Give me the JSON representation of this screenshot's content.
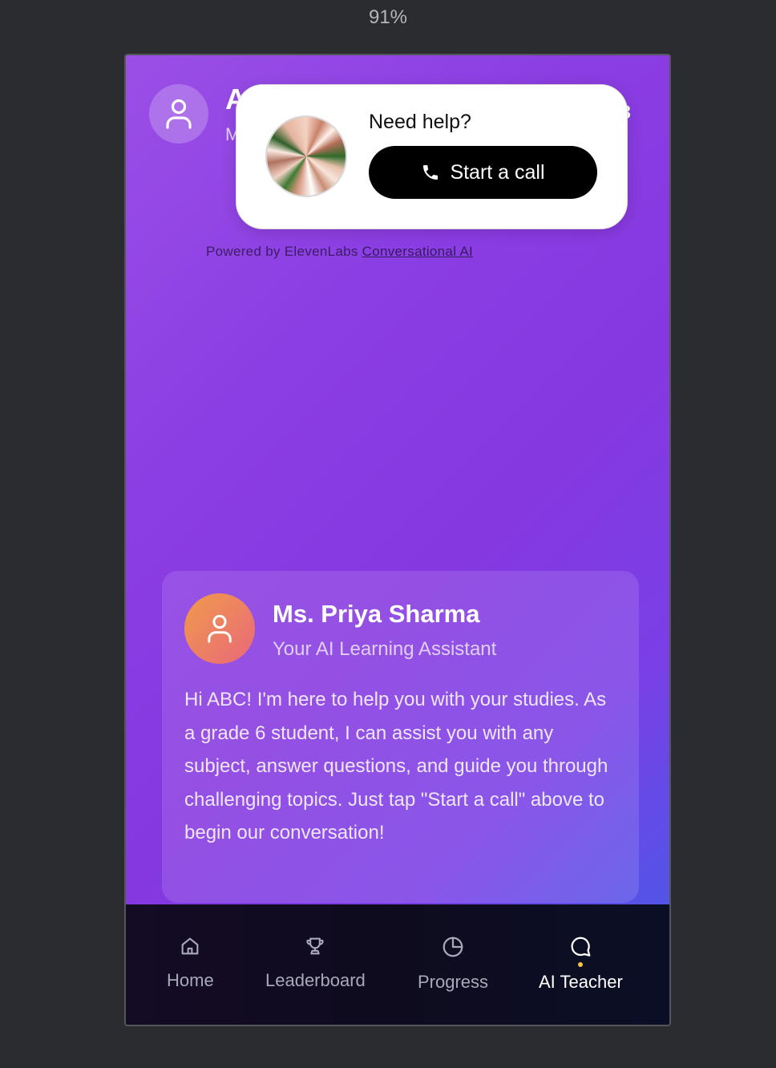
{
  "browser": {
    "zoom": "91%"
  },
  "header": {
    "name_partial": "A",
    "sub_partial": "M",
    "right_partial": "3"
  },
  "widget": {
    "prompt": "Need help?",
    "call_label": "Start a call"
  },
  "powered_by": {
    "text": "Powered by ElevenLabs ",
    "link": "Conversational AI"
  },
  "teacher": {
    "name": "Ms. Priya Sharma",
    "role": "Your AI Learning Assistant",
    "message": "Hi ABC! I'm here to help you with your studies. As a grade 6 student, I can assist you with any subject, answer questions, and guide you through challenging topics. Just tap \"Start a call\" above to begin our conversation!"
  },
  "nav": {
    "items": [
      {
        "label": "Home",
        "icon": "home-icon",
        "active": false
      },
      {
        "label": "Leaderboard",
        "icon": "trophy-icon",
        "active": false
      },
      {
        "label": "Progress",
        "icon": "pie-chart-icon",
        "active": false
      },
      {
        "label": "AI Teacher",
        "icon": "chat-bubble-icon",
        "active": true
      }
    ],
    "active_dot_color": "#f5c542"
  },
  "colors": {
    "gradient_start": "#9b4fe6",
    "gradient_end": "#3f5fe8",
    "button_bg": "#000000"
  }
}
